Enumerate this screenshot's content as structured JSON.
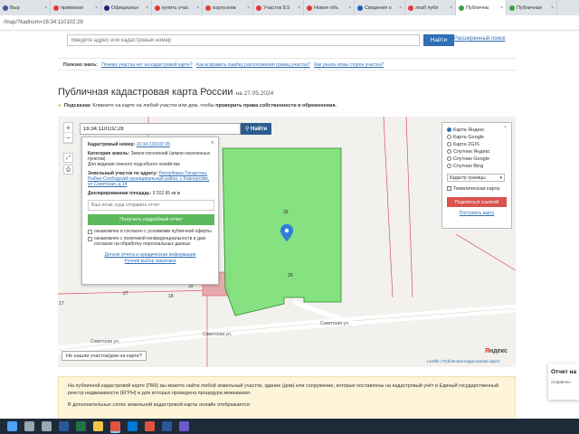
{
  "browser": {
    "tabs": [
      {
        "label": "Выр",
        "color": "#3b5998",
        "active": false
      },
      {
        "label": "приемная",
        "color": "#e53935",
        "active": false
      },
      {
        "label": "Официальн",
        "color": "#1a237e",
        "active": false
      },
      {
        "label": "купить учас",
        "color": "#e53935",
        "active": false
      },
      {
        "label": "корпузнов",
        "color": "#e53935",
        "active": false
      },
      {
        "label": "Участок 8.5",
        "color": "#e53935",
        "active": false
      },
      {
        "label": "Новое объ",
        "color": "#e53935",
        "active": false
      },
      {
        "label": "Сведения о",
        "color": "#1565c0",
        "active": false
      },
      {
        "label": "лкаб публ",
        "color": "#e53935",
        "active": false
      },
      {
        "label": "Публична",
        "color": "#43a047",
        "active": true
      },
      {
        "label": "Публичная",
        "color": "#43a047",
        "active": false
      }
    ],
    "url": "/map/?kadnum=16:34:110102:28"
  },
  "header": {
    "search_placeholder": "Введите адрес или кадастровый номер",
    "search_button": "Найти",
    "advanced_link": "Расширенный поиск"
  },
  "useful": {
    "label": "Полезно знать:",
    "links": [
      "Почему участка нет на кадастровой карте?",
      "Как исправить ошибку расположения границ участка?",
      "Как узнать итмы сторон участка?"
    ]
  },
  "title": {
    "text": "Публичная кадастровая карта России",
    "date": "на 27.05.2024"
  },
  "hint": {
    "label": "Подсказка:",
    "text": "Кликните на карте на любой участок или дом, чтобы",
    "bold": "проверить права собственности и обременения."
  },
  "map": {
    "search_value": "16:34:110102:28",
    "search_button": "Найти",
    "zoom_in": "+",
    "zoom_out": "−",
    "not_found": "Не нашли участок/дом на карте?",
    "yandex_y": "Я",
    "yandex_rest": "ндекс",
    "attribution": "Leaflet | Публичная кадастровая карта",
    "plot_numbers": [
      "28",
      "28",
      "27",
      "18",
      "17",
      "29"
    ],
    "streets": [
      "Советская ул.",
      "Советская ул.",
      "Советская ул."
    ]
  },
  "popup": {
    "cadnum_label": "Кадастровый номер:",
    "cadnum_value": "16:34:110102:28",
    "category_label": "Категория земель:",
    "category_value": "Земли поселений (земли населенных пунктов)",
    "use_value": "Для ведения личного подсобного хозяйства",
    "address_label": "Земельный участок по адресу:",
    "address_value": "Республика Татарстан, Рыбно-Слободский муниципальный район, с Корноухово, ул Советская, д 14",
    "area_label": "Декларированная площадь:",
    "area_value": "3 202.95 кв.м",
    "email_placeholder": "Ваш email, куда отправить отчет",
    "report_button": "Получить подробный отчет",
    "consent1": "ознакомлен и согласен с условиями публичной оферты",
    "consent2": "ознакомлен с политикой конфиденциальности и даю согласие на обработку персональных данных",
    "footer1": "Детали отчета и юридическая информация",
    "footer2": "Ручной выбор заказчика"
  },
  "layers": {
    "options": [
      {
        "label": "Карта Яндекс",
        "checked": true
      },
      {
        "label": "Карта Google",
        "checked": false
      },
      {
        "label": "Карта 2GIS",
        "checked": false
      },
      {
        "label": "Спутник Яндекс",
        "checked": false
      },
      {
        "label": "Спутник Google",
        "checked": false
      },
      {
        "label": "Спутник Bing",
        "checked": false
      }
    ],
    "select_value": "Кадастр границы",
    "thematic_label": "Тематическая карта",
    "share_button": "Поделиться ссылкой",
    "route_link": "Построить карту"
  },
  "info": {
    "text1": "На публичной кадастровой карте (ПКК) вы можете найти любой земельный участок, здание (дом) или сооружение, которые поставлены на кадастровый учёт в Единый государственный реестр недвижимости (ЕГРН) и для которых проведена процедура межевания.",
    "text2": "В дополнительных слоях земельной кадастровой карты онлайн отображается:"
  },
  "notification": {
    "title": "Отчет на",
    "sub": "отправлен"
  },
  "taskbar": {
    "icons": [
      {
        "name": "start-icon",
        "color": "#4aa3ff"
      },
      {
        "name": "search-icon",
        "color": "#9aa6b2"
      },
      {
        "name": "task-view-icon",
        "color": "#9aa6b2"
      },
      {
        "name": "word-icon",
        "color": "#2b579a"
      },
      {
        "name": "excel-icon",
        "color": "#217346"
      },
      {
        "name": "explorer-icon",
        "color": "#f3c54a"
      },
      {
        "name": "chrome-icon",
        "color": "#e0533d"
      },
      {
        "name": "mail-icon",
        "color": "#0078d4"
      },
      {
        "name": "chrome-icon-2",
        "color": "#e0533d"
      },
      {
        "name": "word-icon-2",
        "color": "#2b579a"
      },
      {
        "name": "app-icon",
        "color": "#6a5acd"
      }
    ]
  },
  "colors": {
    "plot_fill": "#7fe07a",
    "plot_stroke": "#2a8a2a",
    "boundary": "#e0505a",
    "accent": "#2f6fb6"
  }
}
